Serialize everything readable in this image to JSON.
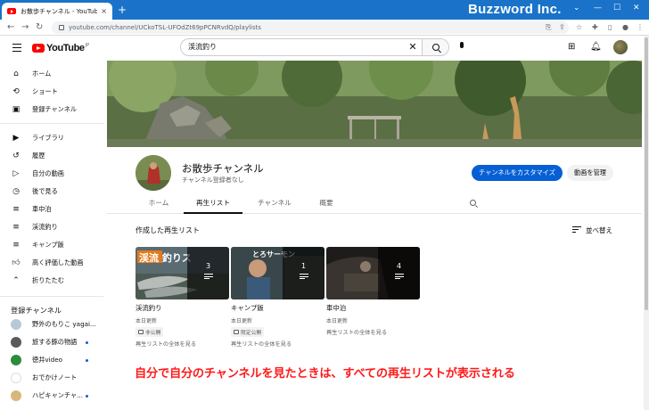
{
  "browser": {
    "tab_title": "お散歩チャンネル - YouTube",
    "tab_close": "×",
    "new_tab": "+",
    "brand": "Buzzword Inc.",
    "url": "youtube.com/channel/UCkoTSL-UFOdZt69pPCNRvdQ/playlists",
    "window_controls": [
      "⌄",
      "—",
      "☐",
      "✕"
    ]
  },
  "masthead": {
    "logo_text": "YouTube",
    "logo_suffix": "JP",
    "search_value": "渓流釣り",
    "clear_glyph": "✕"
  },
  "sidebar": {
    "main": [
      {
        "label": "ホーム",
        "icon": "home-icon"
      },
      {
        "label": "ショート",
        "icon": "shorts-icon"
      },
      {
        "label": "登録チャンネル",
        "icon": "subscriptions-icon"
      }
    ],
    "library": [
      {
        "label": "ライブラリ",
        "icon": "library-icon"
      },
      {
        "label": "履歴",
        "icon": "history-icon"
      },
      {
        "label": "自分の動画",
        "icon": "your-videos-icon"
      },
      {
        "label": "後で見る",
        "icon": "watch-later-icon"
      },
      {
        "label": "車中泊",
        "icon": "playlist-icon"
      },
      {
        "label": "渓流釣り",
        "icon": "playlist-icon"
      },
      {
        "label": "キャンプ飯",
        "icon": "playlist-icon"
      },
      {
        "label": "高く評価した動画",
        "icon": "thumbs-up-icon"
      },
      {
        "label": "折りたたむ",
        "icon": "chevron-up-icon"
      }
    ],
    "subs_heading": "登録チャンネル",
    "subscriptions": [
      {
        "name": "野外のもりこ yagai...",
        "color": "#b7c8d8"
      },
      {
        "name": "旅する豚の物語",
        "color": "#5a5a5a"
      },
      {
        "name": "徳井video",
        "color": "#2e8b3a"
      },
      {
        "name": "おでかけノート",
        "color": "#ffffff"
      },
      {
        "name": "ハピキャンチャ...",
        "color": "#d9b77a"
      }
    ]
  },
  "channel": {
    "name": "お散歩チャンネル",
    "subscribers": "チャンネル登録者なし",
    "customize_button": "チャンネルをカスタマイズ",
    "manage_button": "動画を管理",
    "tabs": [
      "ホーム",
      "再生リスト",
      "チャンネル",
      "概要"
    ],
    "active_tab": "再生リスト"
  },
  "playlists": {
    "section_title": "作成した再生リスト",
    "sort_label": "並べ替え",
    "items": [
      {
        "title": "渓流釣り",
        "count": "3",
        "updated": "本日更新",
        "visibility": "非公開",
        "link": "再生リストの全体を見る",
        "thumb_text": "渓流 釣りス"
      },
      {
        "title": "キャンプ飯",
        "count": "1",
        "updated": "本日更新",
        "visibility": "限定公開",
        "link": "再生リストの全体を見る",
        "thumb_text": "とろサーモン"
      },
      {
        "title": "車中泊",
        "count": "4",
        "updated": "本日更新",
        "visibility": "",
        "link": "再生リストの全体を見る",
        "thumb_text": ""
      }
    ]
  },
  "annotation": "自分で自分のチャンネルを見たときは、すべての再生リストが表示される",
  "colors": {
    "brand_blue": "#1a73c8",
    "yt_red": "#ff0000",
    "cta_blue": "#065fd4",
    "annotation_red": "#ff1a1a"
  }
}
